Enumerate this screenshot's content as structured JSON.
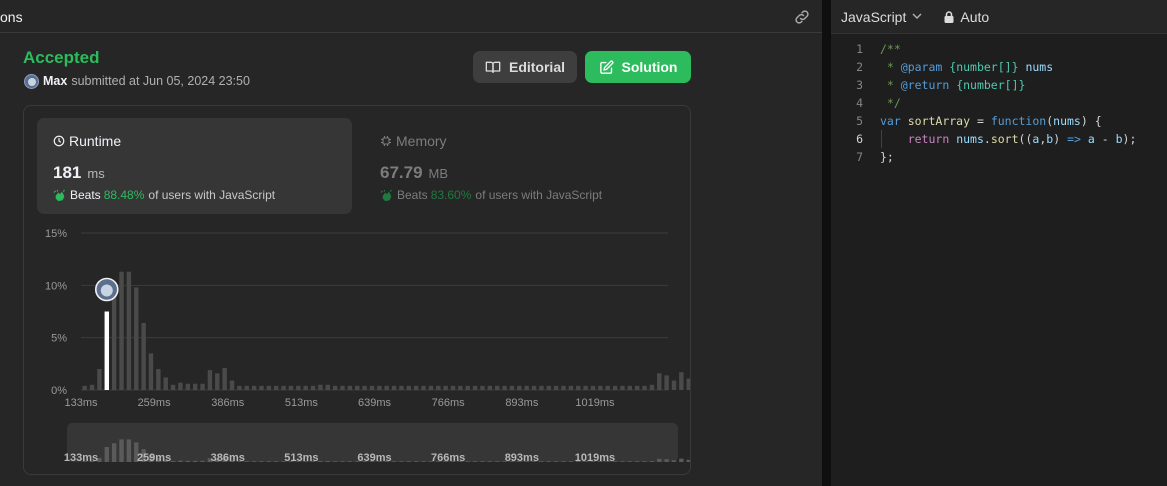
{
  "left_header": {
    "tab_label": "ons"
  },
  "submission": {
    "status": "Accepted",
    "user": "Max",
    "submitted_text": "submitted at Jun 05, 2024 23:50"
  },
  "buttons": {
    "editorial": "Editorial",
    "solution": "Solution"
  },
  "runtime": {
    "title": "Runtime",
    "value": "181",
    "unit": "ms",
    "beats_label": "Beats",
    "beats_pct": "88.48%",
    "beats_suffix": "of users with JavaScript"
  },
  "memory": {
    "title": "Memory",
    "value": "67.79",
    "unit": "MB",
    "beats_label": "Beats",
    "beats_pct": "83.60%",
    "beats_suffix": "of users with JavaScript"
  },
  "chart_data": {
    "type": "bar",
    "title": "",
    "xlabel": "",
    "ylabel": "",
    "y_ticks": [
      "15%",
      "10%",
      "5%",
      "0%"
    ],
    "ylim": [
      0,
      15
    ],
    "x_ticks": [
      "133ms",
      "259ms",
      "386ms",
      "513ms",
      "639ms",
      "766ms",
      "893ms",
      "1019ms"
    ],
    "x_tick_values": [
      133,
      259,
      386,
      513,
      639,
      766,
      893,
      1019
    ],
    "xlim": [
      133,
      1145
    ],
    "bin_width_ms": 12.7,
    "values": [
      0.4,
      0.5,
      2.0,
      7.5,
      9.4,
      11.3,
      11.3,
      9.8,
      6.4,
      3.5,
      2.0,
      1.2,
      0.5,
      0.7,
      0.6,
      0.6,
      0.6,
      1.9,
      1.6,
      2.1,
      0.9,
      0.4,
      0.4,
      0.4,
      0.4,
      0.4,
      0.4,
      0.4,
      0.4,
      0.4,
      0.4,
      0.4,
      0.5,
      0.5,
      0.4,
      0.4,
      0.4,
      0.4,
      0.4,
      0.4,
      0.4,
      0.4,
      0.4,
      0.4,
      0.4,
      0.4,
      0.4,
      0.4,
      0.4,
      0.4,
      0.4,
      0.4,
      0.4,
      0.4,
      0.4,
      0.4,
      0.4,
      0.4,
      0.4,
      0.4,
      0.4,
      0.4,
      0.4,
      0.4,
      0.4,
      0.4,
      0.4,
      0.4,
      0.4,
      0.4,
      0.4,
      0.4,
      0.4,
      0.4,
      0.4,
      0.4,
      0.4,
      0.5,
      1.6,
      1.4,
      0.9,
      1.7,
      1.1,
      1.2,
      0.6
    ],
    "highlighted_bin": 3,
    "user_runtime_ms": 181,
    "bar_color": "#4a4a4a",
    "highlight_color": "#ffffff",
    "gridlines": true
  },
  "editor": {
    "language": "JavaScript",
    "mode": "Auto",
    "lines": [
      {
        "n": "1",
        "tokens": [
          [
            "c-comment",
            "/**"
          ]
        ]
      },
      {
        "n": "2",
        "tokens": [
          [
            "c-comment",
            " * "
          ],
          [
            "c-tag",
            "@param"
          ],
          [
            "c-comment",
            " "
          ],
          [
            "c-type",
            "{number[]}"
          ],
          [
            "c-comment",
            " "
          ],
          [
            "c-var",
            "nums"
          ]
        ]
      },
      {
        "n": "3",
        "tokens": [
          [
            "c-comment",
            " * "
          ],
          [
            "c-tag",
            "@return"
          ],
          [
            "c-comment",
            " "
          ],
          [
            "c-type",
            "{number[]}"
          ]
        ]
      },
      {
        "n": "4",
        "tokens": [
          [
            "c-comment",
            " */"
          ]
        ]
      },
      {
        "n": "5",
        "tokens": [
          [
            "c-kw",
            "var"
          ],
          [
            "c-punc",
            " "
          ],
          [
            "c-fn",
            "sortArray"
          ],
          [
            "c-punc",
            " = "
          ],
          [
            "c-kw",
            "function"
          ],
          [
            "c-punc",
            "("
          ],
          [
            "c-var",
            "nums"
          ],
          [
            "c-punc",
            ") {"
          ]
        ]
      },
      {
        "n": "6",
        "tokens": [
          [
            "c-punc",
            "    "
          ],
          [
            "c-ctrl",
            "return"
          ],
          [
            "c-punc",
            " "
          ],
          [
            "c-var",
            "nums"
          ],
          [
            "c-punc",
            "."
          ],
          [
            "c-fn",
            "sort"
          ],
          [
            "c-punc",
            "(("
          ],
          [
            "c-var",
            "a"
          ],
          [
            "c-punc",
            ","
          ],
          [
            "c-var",
            "b"
          ],
          [
            "c-punc",
            ") "
          ],
          [
            "c-kw",
            "=>"
          ],
          [
            "c-punc",
            " "
          ],
          [
            "c-var",
            "a"
          ],
          [
            "c-punc",
            " - "
          ],
          [
            "c-var",
            "b"
          ],
          [
            "c-punc",
            ");"
          ]
        ],
        "active": true,
        "guide": true
      },
      {
        "n": "7",
        "tokens": [
          [
            "c-punc",
            "};"
          ]
        ]
      }
    ]
  },
  "colors": {
    "accent_green": "#2cbb5d",
    "panel_bg": "#262626",
    "editor_bg": "#1e1e1e"
  }
}
